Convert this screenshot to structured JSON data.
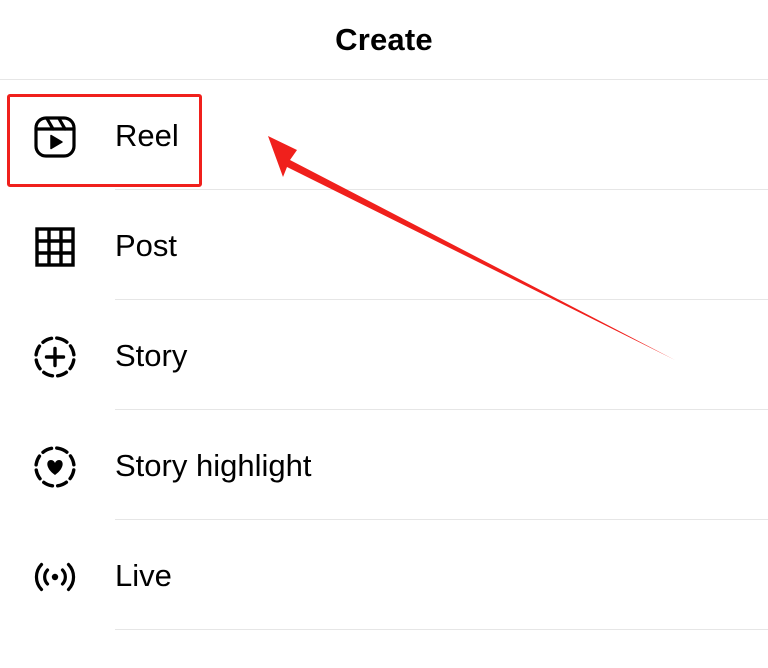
{
  "header": {
    "title": "Create"
  },
  "menu": {
    "items": [
      {
        "label": "Reel",
        "icon": "reel-icon"
      },
      {
        "label": "Post",
        "icon": "grid-icon"
      },
      {
        "label": "Story",
        "icon": "story-add-icon"
      },
      {
        "label": "Story highlight",
        "icon": "story-highlight-icon"
      },
      {
        "label": "Live",
        "icon": "live-icon"
      }
    ]
  },
  "annotation": {
    "color": "#f0201c",
    "target": "Reel"
  }
}
